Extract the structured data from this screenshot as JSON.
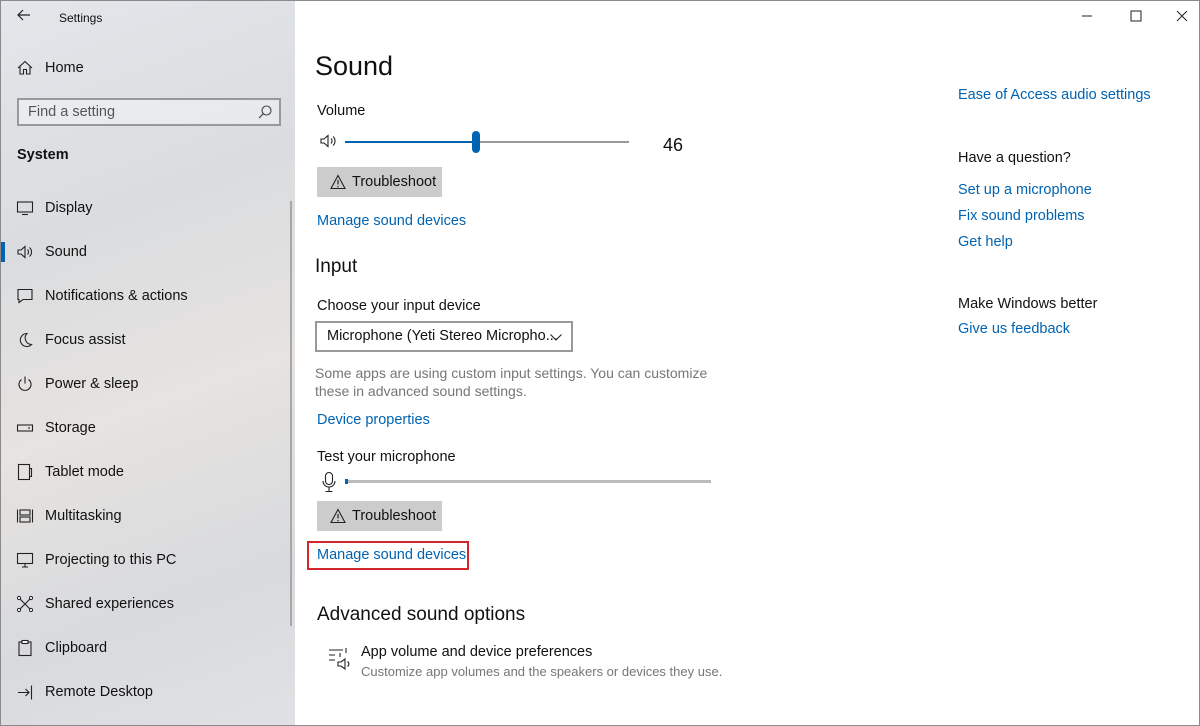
{
  "window": {
    "title": "Settings",
    "controls": {
      "minimize": "—",
      "maximize": "☐",
      "close": "✕"
    }
  },
  "sidebar": {
    "back_icon": "back-arrow-icon",
    "home_label": "Home",
    "search": {
      "placeholder": "Find a setting"
    },
    "section_title": "System",
    "items": [
      {
        "label": "Display",
        "icon": "display-icon",
        "active": false
      },
      {
        "label": "Sound",
        "icon": "speaker-icon",
        "active": true
      },
      {
        "label": "Notifications & actions",
        "icon": "notification-icon",
        "active": false
      },
      {
        "label": "Focus assist",
        "icon": "moon-icon",
        "active": false
      },
      {
        "label": "Power & sleep",
        "icon": "power-icon",
        "active": false
      },
      {
        "label": "Storage",
        "icon": "storage-icon",
        "active": false
      },
      {
        "label": "Tablet mode",
        "icon": "tablet-icon",
        "active": false
      },
      {
        "label": "Multitasking",
        "icon": "multitasking-icon",
        "active": false
      },
      {
        "label": "Projecting to this PC",
        "icon": "projecting-icon",
        "active": false
      },
      {
        "label": "Shared experiences",
        "icon": "shared-icon",
        "active": false
      },
      {
        "label": "Clipboard",
        "icon": "clipboard-icon",
        "active": false
      },
      {
        "label": "Remote Desktop",
        "icon": "remote-desktop-icon",
        "active": false
      }
    ]
  },
  "main": {
    "title": "Sound",
    "volume": {
      "label": "Volume",
      "value": "46",
      "level": 0.46
    },
    "troubleshoot_label": "Troubleshoot",
    "manage_devices_label": "Manage sound devices",
    "input": {
      "heading": "Input",
      "choose_label": "Choose your input device",
      "device_value": "Microphone (Yeti Stereo Micropho...",
      "help_text": "Some apps are using custom input settings. You can customize these in advanced sound settings.",
      "device_properties": "Device properties",
      "test_label": "Test your microphone",
      "mic_level": 0.01,
      "troubleshoot_label": "Troubleshoot",
      "manage_devices_label": "Manage sound devices"
    },
    "advanced": {
      "heading": "Advanced sound options",
      "item_title": "App volume and device preferences",
      "item_subtitle": "Customize app volumes and the speakers or devices they use."
    }
  },
  "related": {
    "ease_link": "Ease of Access audio settings",
    "question_heading": "Have a question?",
    "links": [
      "Set up a microphone",
      "Fix sound problems",
      "Get help"
    ],
    "better_heading": "Make Windows better",
    "feedback_link": "Give us feedback"
  },
  "colors": {
    "accent": "#0063b1",
    "highlight": "#d6262d"
  }
}
